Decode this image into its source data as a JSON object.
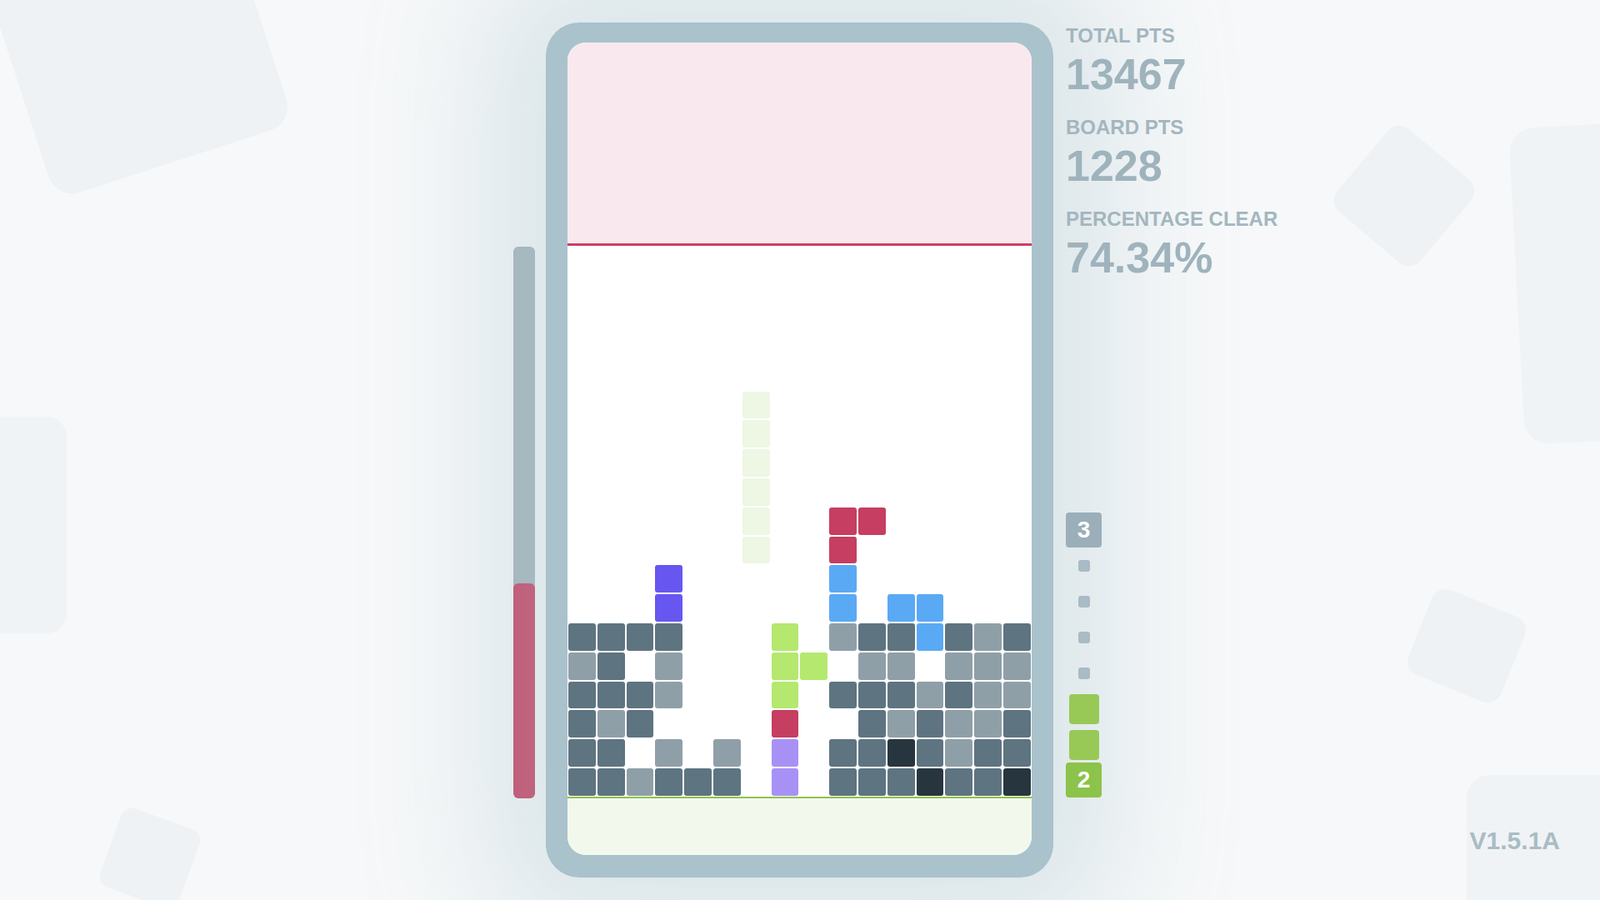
{
  "hud": {
    "stats": [
      {
        "label": "TOTAL PTS",
        "value": "13467"
      },
      {
        "label": "BOARD PTS",
        "value": "1228"
      },
      {
        "label": "PERCENTAGE CLEAR",
        "value": "74.34%"
      }
    ]
  },
  "pressure_meter": {
    "level": 0.39
  },
  "board": {
    "legend": {
      "D": "#5e7480",
      "L": "#8f9fa8",
      "K": "#27353e",
      "G": "#b4e86e",
      "R": "#c63e62",
      "B": "#5aa9f5",
      "P": "#6757f0",
      "V": "#a891f5",
      "g": "#eef6e4"
    },
    "rows": [
      "................",
      "................",
      "................",
      "................",
      "................",
      "................",
      "................",
      "................",
      "................",
      "................",
      "................",
      "................",
      "......g.........",
      "......g.........",
      "......g.........",
      "......g.........",
      "......g..RR.....",
      "......g..R......",
      "...P.....B......",
      "...P.....B.BB...",
      "DDDD...G.LDDBDLD",
      "LD.L...GG.LL.LLL",
      "DDDL...G.DDDLDLL",
      "DLD....R..DLDLLD",
      "DD.L.L.V.DDKDLDD",
      "DDLDDD.V.DDDKDDK"
    ],
    "danger_rows": 7
  },
  "queue": [
    {
      "kind": "count",
      "text": "3",
      "color": "#9aafb9"
    },
    {
      "kind": "dot"
    },
    {
      "kind": "dot"
    },
    {
      "kind": "dot"
    },
    {
      "kind": "dot"
    },
    {
      "kind": "block",
      "color": "#98c957"
    },
    {
      "kind": "block",
      "color": "#98c957"
    },
    {
      "kind": "count",
      "text": "2",
      "color": "#8cc34a"
    }
  ],
  "version": "V1.5.1A"
}
